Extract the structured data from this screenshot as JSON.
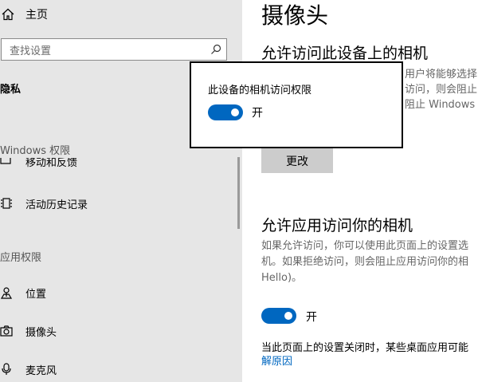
{
  "sidebar": {
    "home_label": "主页",
    "search_placeholder": "查找设置",
    "privacy_heading": "隐私",
    "windows_permissions_label": "Windows 权限",
    "items_windows": [
      {
        "label": "移动和反馈",
        "icon": "chat-icon"
      },
      {
        "label": "活动历史记录",
        "icon": "activity-history-icon"
      }
    ],
    "app_permissions_label": "应用权限",
    "items_app": [
      {
        "label": "位置",
        "icon": "location-icon"
      },
      {
        "label": "摄像头",
        "icon": "camera-icon"
      },
      {
        "label": "麦克风",
        "icon": "microphone-icon"
      }
    ]
  },
  "main": {
    "title": "摄像头",
    "allow_device_heading": "允许访问此设备上的相机",
    "device_desc": [
      "用户将能够选择",
      "访问，则会阻止",
      "阻止 Windows H"
    ],
    "change_button": "更改",
    "allow_apps_heading": "允许应用访问你的相机",
    "apps_desc": [
      "如果允许访问，你可以使用此页面上的设置选",
      "机。如果拒绝访问，则会阻止应用访问你的相",
      "Hello)。"
    ],
    "apps_toggle_label": "开",
    "note": "当此页面上的设置关闭时，某些桌面应用可能",
    "link": "解原因"
  },
  "popup": {
    "title": "此设备的相机访问权限",
    "toggle_label": "开",
    "toggle_on": true
  },
  "colors": {
    "accent": "#0067c0",
    "sidebar_bg": "#e6e6e6",
    "button_bg": "#cccccc"
  }
}
